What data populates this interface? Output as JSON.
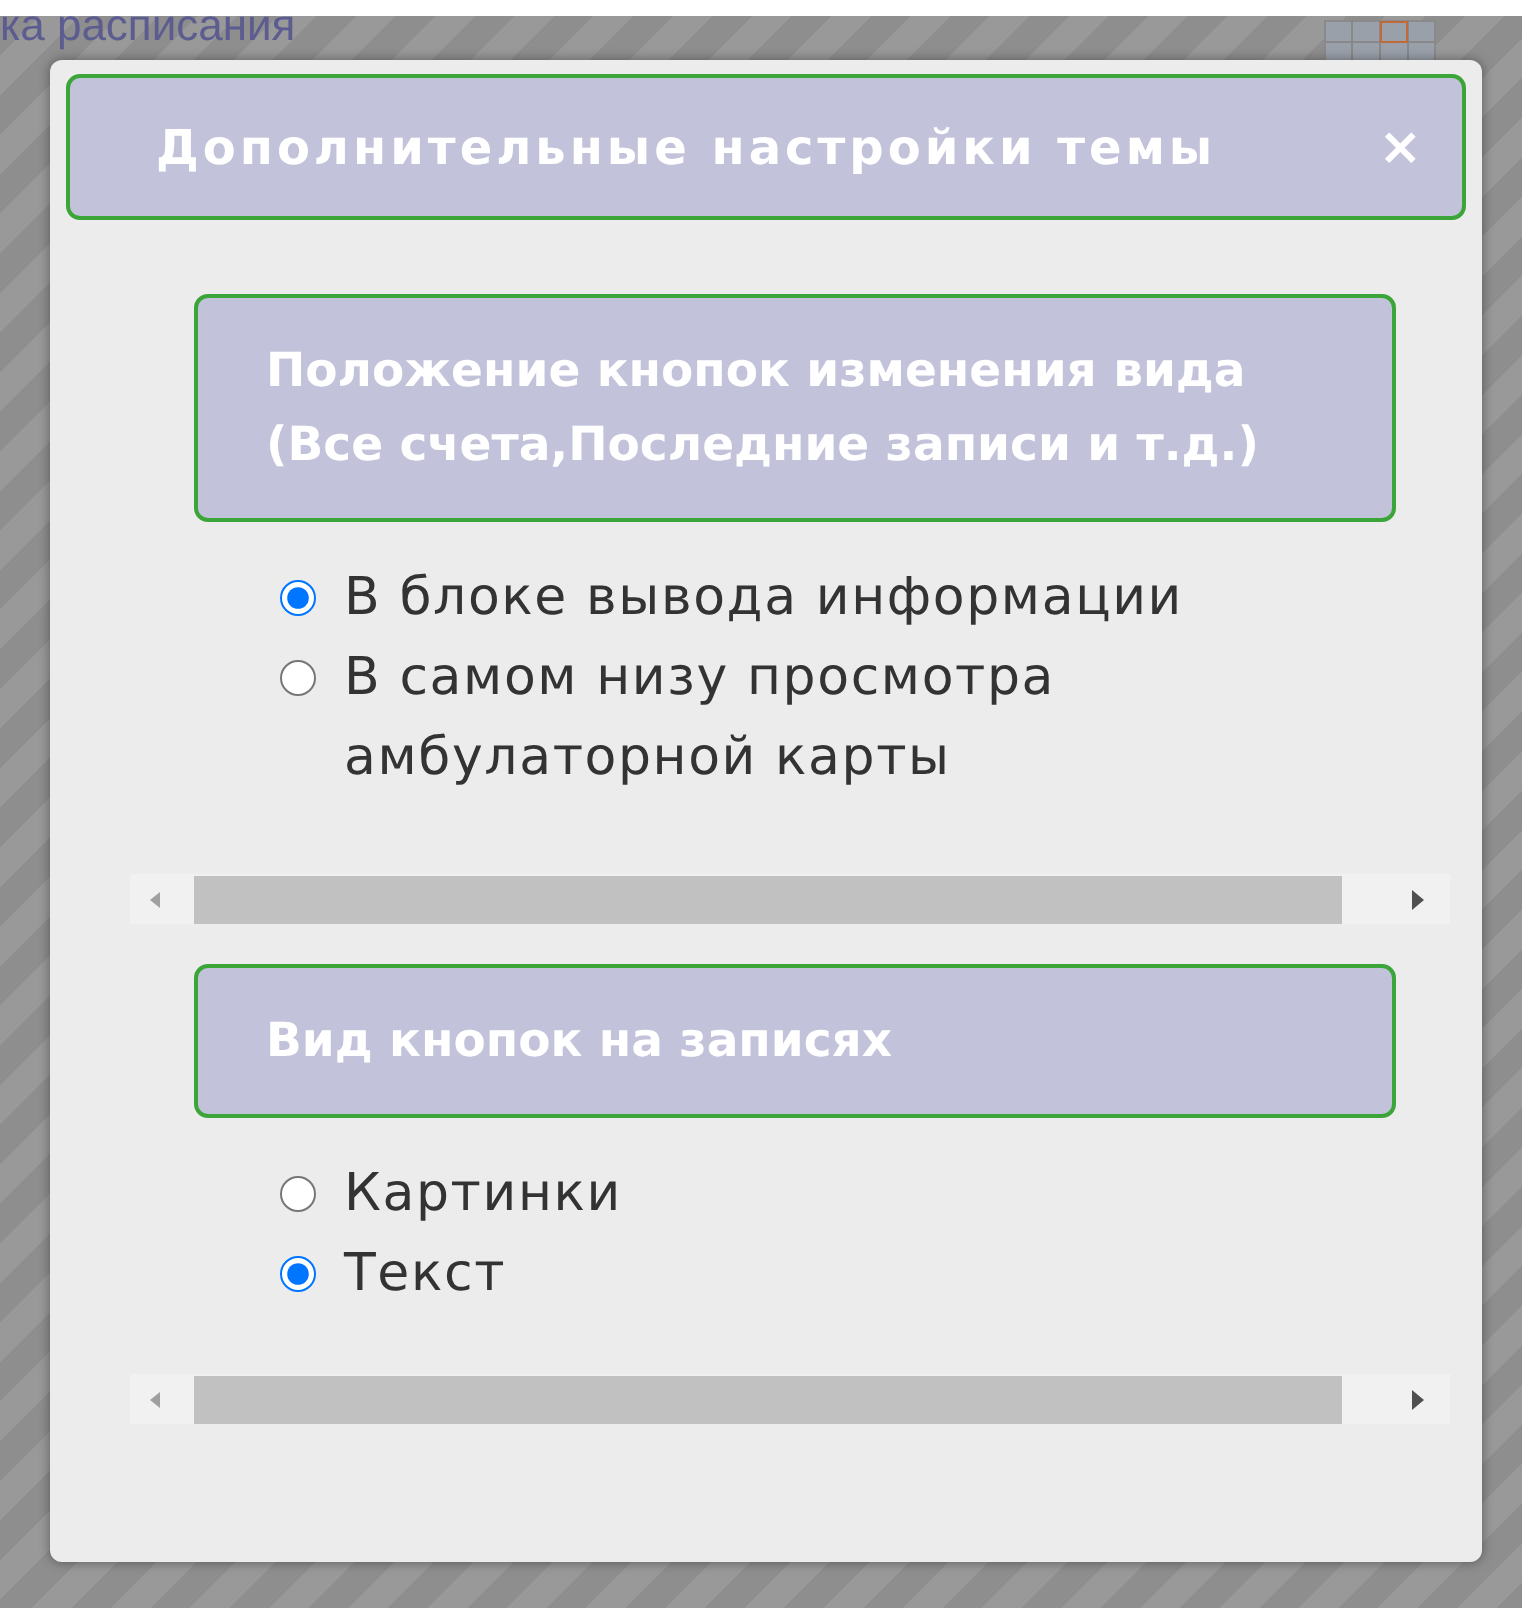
{
  "background": {
    "heading": "ка расписания"
  },
  "dialog": {
    "title": "Дополнительные настройки темы",
    "close": "×",
    "sections": [
      {
        "title": "Положение кнопок изменения вида (Все счета,Последние записи и т.д.)",
        "options": [
          {
            "label": "В блоке вывода информации",
            "selected": true
          },
          {
            "label": "В самом низу просмотра амбулаторной карты",
            "selected": false
          }
        ]
      },
      {
        "title": "Вид кнопок на записях",
        "options": [
          {
            "label": "Картинки",
            "selected": false
          },
          {
            "label": "Текст",
            "selected": true
          }
        ]
      }
    ]
  }
}
